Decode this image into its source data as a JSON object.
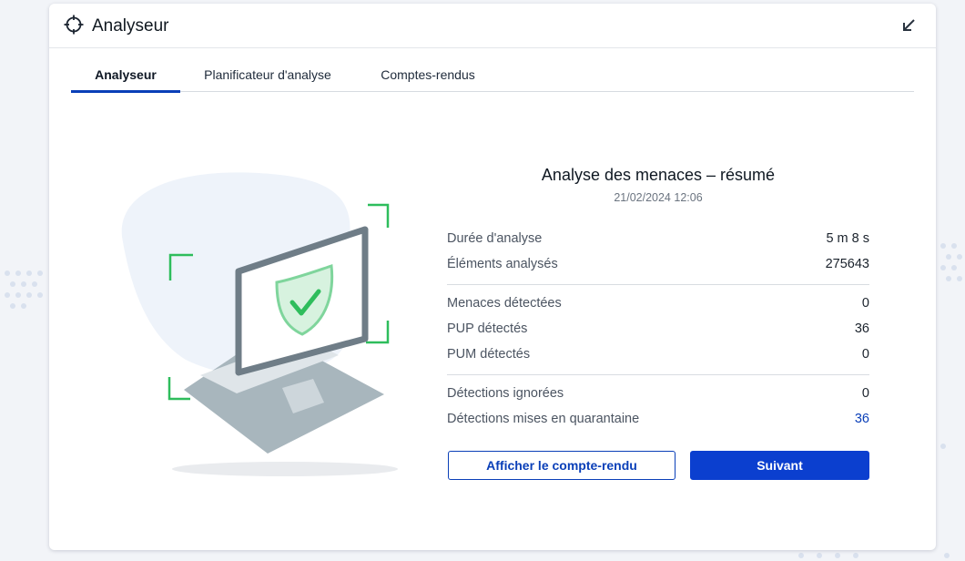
{
  "window": {
    "title": "Analyseur"
  },
  "tabs": [
    {
      "label": "Analyseur",
      "active": true
    },
    {
      "label": "Planificateur d'analyse",
      "active": false
    },
    {
      "label": "Comptes-rendus",
      "active": false
    }
  ],
  "summary": {
    "title": "Analyse des menaces – résumé",
    "date": "21/02/2024 12:06",
    "rows": [
      {
        "label": "Durée d'analyse",
        "value": "5 m 8 s"
      },
      {
        "label": "Éléments analysés",
        "value": "275643"
      },
      {
        "label": "Menaces détectées",
        "value": "0"
      },
      {
        "label": "PUP détectés",
        "value": "36"
      },
      {
        "label": "PUM détectés",
        "value": "0"
      },
      {
        "label": "Détections ignorées",
        "value": "0"
      },
      {
        "label": "Détections mises en quarantaine",
        "value": "36"
      }
    ]
  },
  "buttons": {
    "report": "Afficher le compte-rendu",
    "next": "Suivant"
  },
  "colors": {
    "accent": "#0b3fcf",
    "link": "#0a3fb8",
    "shield_green": "#2ebd5c",
    "laptop_gray": "#6f7d87"
  },
  "icons": {
    "header": "crosshair-icon",
    "collapse": "arrow-down-left-icon"
  }
}
